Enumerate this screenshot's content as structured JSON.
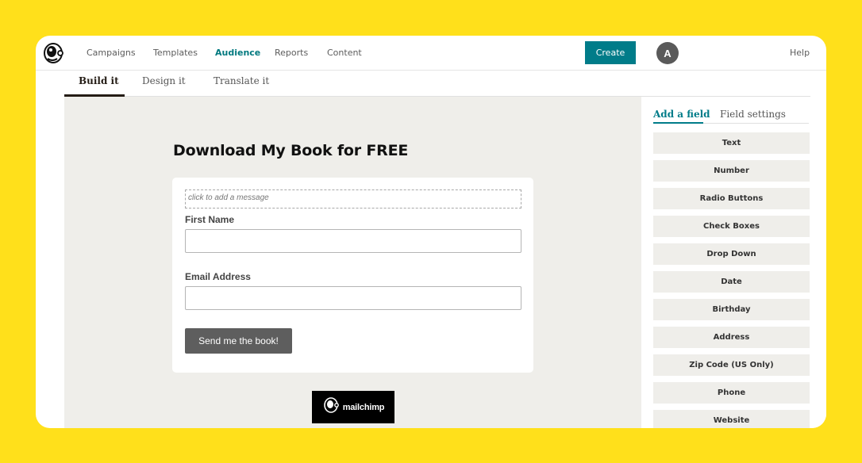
{
  "nav": {
    "items": [
      "Campaigns",
      "Templates",
      "Audience",
      "Reports",
      "Content"
    ],
    "create_label": "Create",
    "avatar_initial": "A",
    "help_label": "Help"
  },
  "subtabs": [
    "Build it",
    "Design it",
    "Translate it"
  ],
  "form": {
    "title": "Download My Book for FREE",
    "message_placeholder": "click to add a message",
    "first_name_label": "First Name",
    "email_label": "Email Address",
    "submit_label": "Send me the book!",
    "badge_text": "mailchimp"
  },
  "panel": {
    "tabs": [
      "Add a field",
      "Field settings"
    ],
    "fields": [
      "Text",
      "Number",
      "Radio Buttons",
      "Check Boxes",
      "Drop Down",
      "Date",
      "Birthday",
      "Address",
      "Zip Code (US Only)",
      "Phone",
      "Website"
    ]
  },
  "colors": {
    "background": "#ffe01b",
    "accent": "#007c89",
    "canvas": "#efeeea"
  }
}
